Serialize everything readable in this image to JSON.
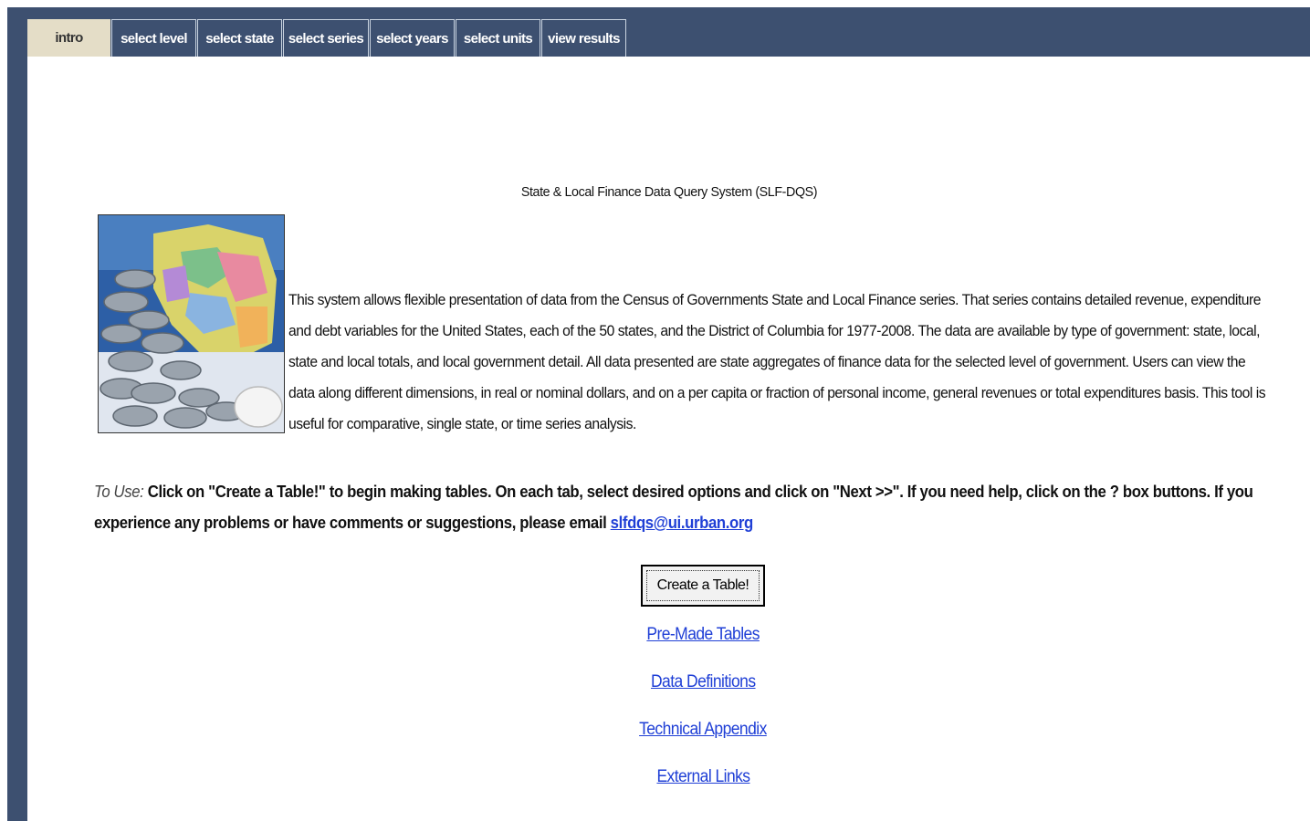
{
  "tabs": [
    {
      "label": "intro",
      "active": true
    },
    {
      "label": "select level",
      "active": false
    },
    {
      "label": "select state",
      "active": false
    },
    {
      "label": "select series",
      "active": false
    },
    {
      "label": "select years",
      "active": false
    },
    {
      "label": "select units",
      "active": false
    },
    {
      "label": "view results",
      "active": false
    }
  ],
  "main": {
    "title": "State & Local Finance Data Query System (SLF-DQS)",
    "description": "This system allows flexible presentation of data from the Census of Governments State and Local Finance series. That series contains detailed revenue, expenditure and debt variables for the United States, each of the 50 states, and the District of Columbia for 1977-2008. The data are available by type of government: state, local, state and local totals, and local government detail. All data presented are state aggregates of finance data for the selected level of government. Users can view the data along different dimensions, in real or nominal dollars, and on a per capita or fraction of personal income, general revenues or total expenditures basis. This tool is useful for comparative, single state, or time series analysis.",
    "to_use_label": "To Use:",
    "to_use_text": " Click on \"Create a Table!\" to begin making tables. On each tab, select desired options and click on \"Next >>\". If you need help, click on the ? box buttons. If you experience any problems or have comments or suggestions, please email ",
    "email": "slfdqs@ui.urban.org",
    "create_button": "Create a Table!",
    "links": [
      "Pre-Made Tables",
      "Data Definitions",
      "Technical Appendix",
      "External Links"
    ]
  },
  "colors": {
    "frame": "#3d5070",
    "active_tab": "#e4ddc7",
    "link": "#1f3fd6"
  }
}
